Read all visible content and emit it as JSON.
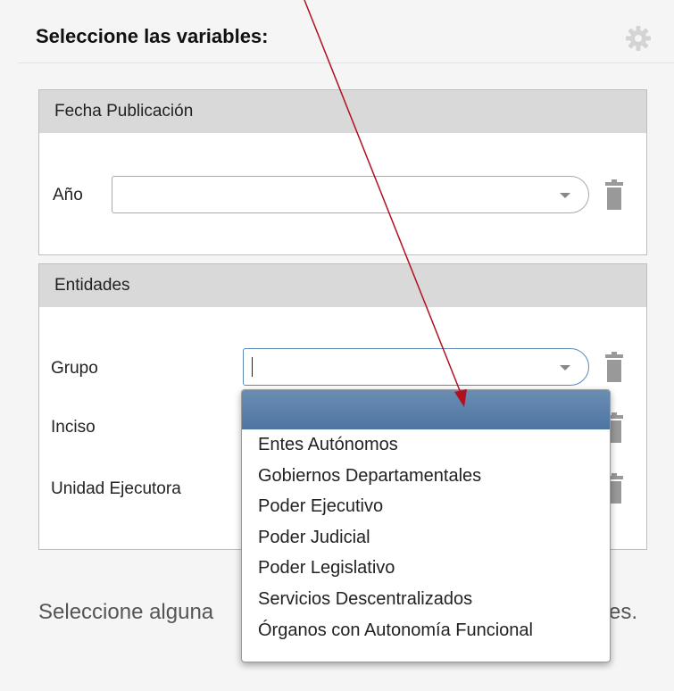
{
  "header": {
    "title": "Seleccione las variables:",
    "settings_icon": "gear-icon"
  },
  "panels": [
    {
      "title": "Fecha Publicación",
      "fields": [
        {
          "label": "Año",
          "value": ""
        }
      ]
    },
    {
      "title": "Entidades",
      "fields": [
        {
          "label": "Grupo",
          "value": ""
        },
        {
          "label": "Inciso",
          "value": ""
        },
        {
          "label": "Unidad Ejecutora",
          "value": ""
        }
      ]
    }
  ],
  "hint_left": "Seleccione alguna",
  "hint_right": "es.",
  "dropdown": {
    "highlighted": "",
    "options": [
      "Entes Autónomos",
      "Gobiernos Departamentales",
      "Poder Ejecutivo",
      "Poder Judicial",
      "Poder Legislativo",
      "Servicios Descentralizados",
      "Órganos con Autonomía Funcional"
    ]
  },
  "colors": {
    "annotation_arrow": "#b01020",
    "highlight": "#4d75a2",
    "focus_border": "#5a8ab8"
  }
}
